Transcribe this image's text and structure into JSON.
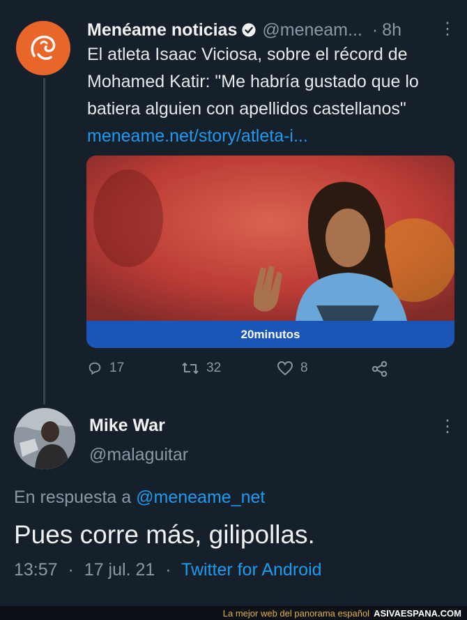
{
  "tweet": {
    "author_name": "Menéame noticias",
    "handle": "@meneam...",
    "time": "8h",
    "text_lines": [
      "El atleta Isaac Viciosa, sobre el récord de",
      "Mohamed Katir: \"Me habría gustado que lo",
      "batiera alguien con apellidos castellanos\""
    ],
    "link": "meneame.net/story/atleta-i...",
    "card_source": "20minutos",
    "replies": "17",
    "retweets": "32",
    "likes": "8"
  },
  "reply": {
    "author_name": "Mike War",
    "handle": "@malaguitar",
    "reply_prefix": "En respuesta a",
    "reply_mention": "@meneame_net",
    "text": "Pues corre más, gilipollas.",
    "time": "13:57",
    "date": "17 jul. 21",
    "client": "Twitter for Android"
  },
  "footer": {
    "tagline": "La mejor web del panorama español",
    "brand": "ASIVAESPANA.COM"
  },
  "colors": {
    "background": "#15202b",
    "link": "#1d9bf0",
    "avatar_orange": "#e8662a",
    "card_bar": "#1a56b8"
  }
}
